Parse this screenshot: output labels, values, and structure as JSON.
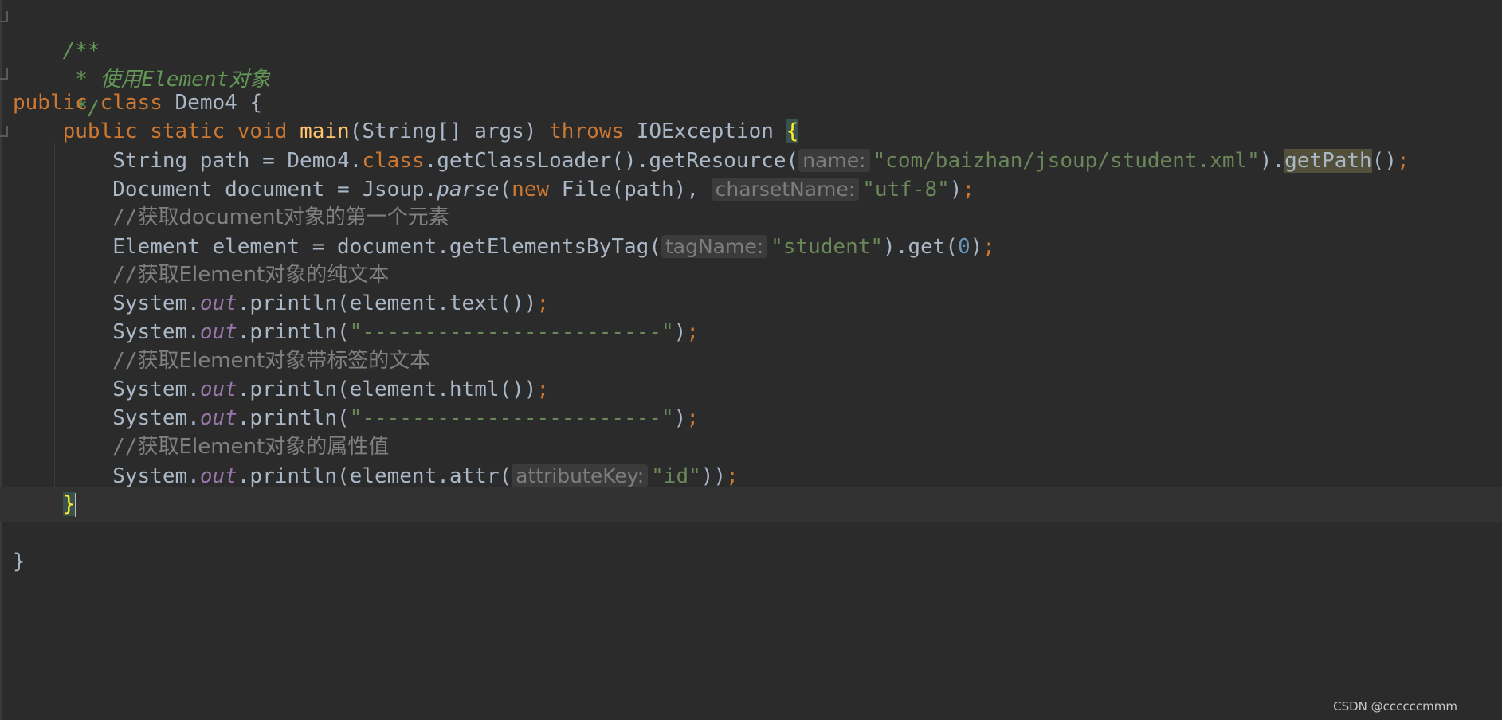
{
  "editor": {
    "lines": {
      "l1": {
        "text": "/**"
      },
      "l2": {
        "star": " * ",
        "word_use": "使用",
        "word_element": "Element",
        "word_obj": "对象"
      },
      "l3": {
        "text": " */"
      },
      "l4": {
        "kw_public": "public",
        "kw_class": "class",
        "name": "Demo4",
        "brace": "{"
      },
      "l5": {
        "kw_public": "public",
        "kw_static": "static",
        "kw_void": "void",
        "method": "main",
        "params": "(String[] args)",
        "kw_throws": "throws",
        "exception": "IOException",
        "brace": "{"
      },
      "l6": {
        "decl": "String path = Demo4.",
        "kw_class": "class",
        "call": ".getClassLoader().getResource(",
        "hint": "name:",
        "str": "\"com/baizhan/jsoup/student.xml\"",
        "close": ").",
        "get_path": "getPath",
        "tail": "()",
        "semi": ";"
      },
      "l7": {
        "decl": "Document document = Jsoup.",
        "parse": "parse",
        "open": "(",
        "kw_new": "new",
        "file": "File(path),",
        "hint": "charsetName:",
        "str": "\"utf-8\"",
        "close": ")",
        "semi": ";"
      },
      "l8": {
        "slashes": "//",
        "text": "获取document对象的第一个元素"
      },
      "l9": {
        "decl": "Element element = document.getElementsByTag(",
        "hint": "tagName:",
        "str": "\"student\"",
        "mid": ").get(",
        "num": "0",
        "close": ")",
        "semi": ";"
      },
      "l10": {
        "slashes": "//",
        "text": "获取Element对象的纯文本"
      },
      "l11": {
        "sys": "System.",
        "out": "out",
        "call": ".println(element.text())",
        "semi": ";"
      },
      "l12": {
        "sys": "System.",
        "out": "out",
        "call": ".println(",
        "str": "\"------------------------\"",
        "close": ")",
        "semi": ";"
      },
      "l13": {
        "slashes": "//",
        "text": "获取Element对象带标签的文本"
      },
      "l14": {
        "sys": "System.",
        "out": "out",
        "call": ".println(element.html())",
        "semi": ";"
      },
      "l15": {
        "sys": "System.",
        "out": "out",
        "call": ".println(",
        "str": "\"------------------------\"",
        "close": ")",
        "semi": ";"
      },
      "l16": {
        "slashes": "//",
        "text": "获取Element对象的属性值"
      },
      "l17": {
        "sys": "System.",
        "out": "out",
        "call": ".println(element.attr(",
        "hint": "attributeKey:",
        "str": "\"id\"",
        "close": "))",
        "semi": ";"
      },
      "l18": {
        "brace": "}"
      },
      "l20": {
        "brace": "}"
      }
    },
    "colors": {
      "background": "#2b2b2b",
      "keyword": "#cc7832",
      "string": "#6a8759",
      "comment": "#808080",
      "doc_comment": "#629755",
      "method_decl": "#ffc66d",
      "static_field": "#9876aa",
      "number": "#6897bb"
    }
  },
  "watermark": "CSDN @ccccccmmm"
}
